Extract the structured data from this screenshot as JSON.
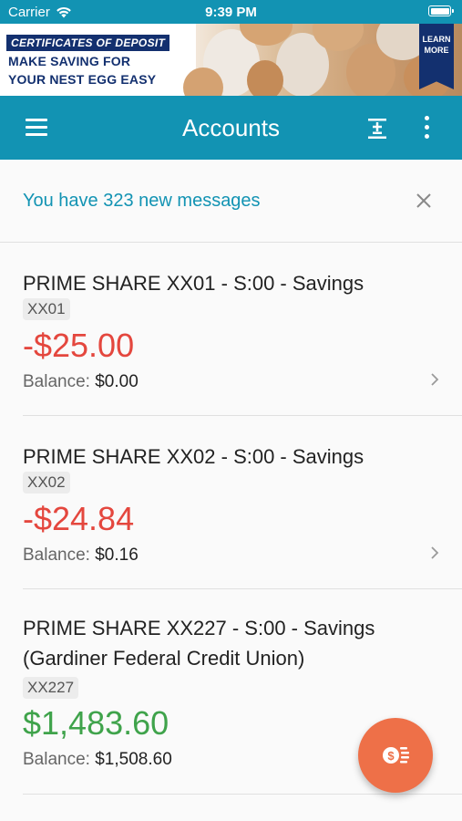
{
  "status_bar": {
    "carrier": "Carrier",
    "time": "9:39 PM"
  },
  "ad": {
    "headline": "CERTIFICATES OF DEPOSIT",
    "line1": "MAKE SAVING FOR",
    "line2": "YOUR NEST EGG EASY",
    "learn_more_1": "LEARN",
    "learn_more_2": "MORE",
    "brand_color": "#13306f"
  },
  "app_bar": {
    "title": "Accounts",
    "color": "#1293b3"
  },
  "messages_banner": {
    "text": "You have 323 new messages"
  },
  "accounts": [
    {
      "name": "PRIME SHARE XX01 - S:00 - Savings",
      "id": "XX01",
      "amount": "-$25.00",
      "balance_label": "Balance:",
      "balance": "$0.00"
    },
    {
      "name": "PRIME SHARE XX02 - S:00 - Savings",
      "id": "XX02",
      "amount": "-$24.84",
      "balance_label": "Balance:",
      "balance": "$0.16"
    },
    {
      "name": "PRIME SHARE XX227 - S:00 - Savings (Gardiner Federal Credit Union)",
      "id": "XX227",
      "amount": "$1,483.60",
      "balance_label": "Balance:",
      "balance": "$1,508.60"
    }
  ],
  "colors": {
    "negative": "#e4473e",
    "positive": "#3fa34b",
    "fab": "#ee7048"
  },
  "icons": {
    "menu": "hamburger-menu-icon",
    "calculator": "plus-minus-icon",
    "more": "more-vertical-icon",
    "close": "close-icon",
    "chevron": "chevron-right-icon",
    "fab": "dollar-transfer-icon"
  }
}
